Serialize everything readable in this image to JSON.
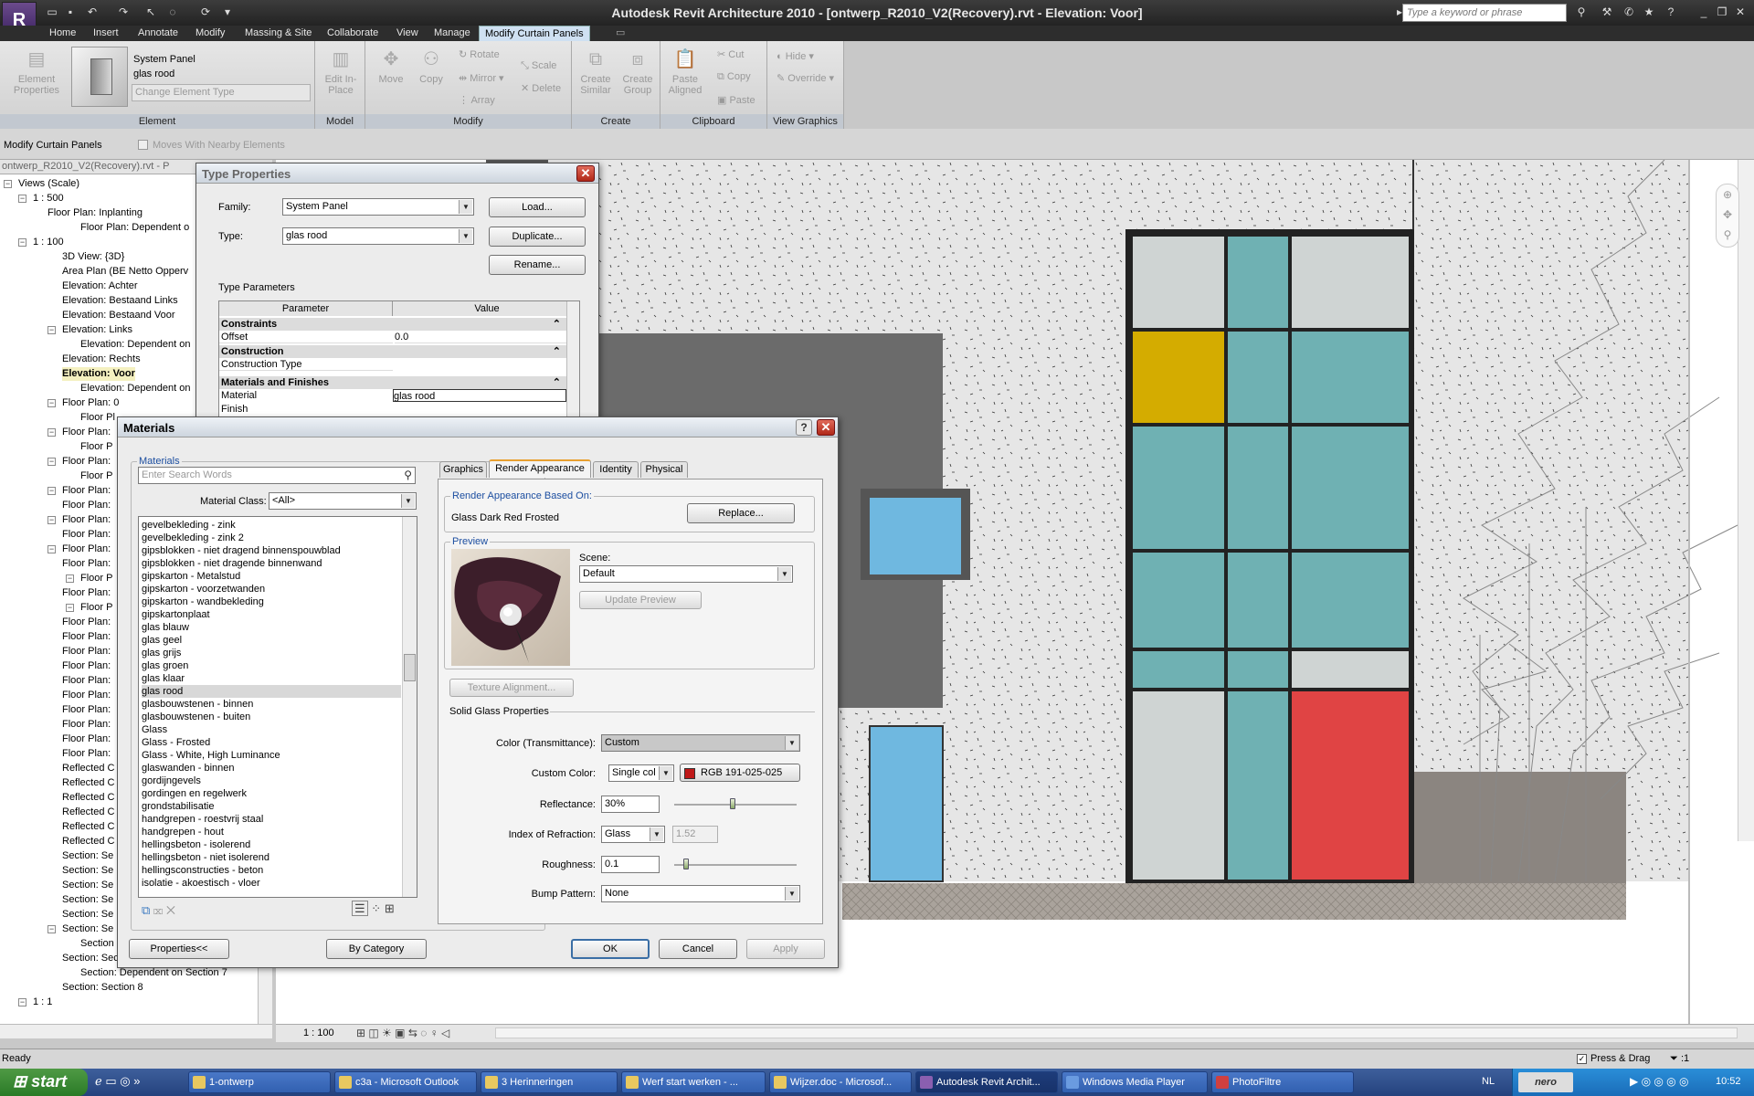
{
  "app": {
    "title": "Autodesk Revit Architecture 2010 - [ontwerp_R2010_V2(Recovery).rvt - Elevation: Voor]",
    "search_placeholder": "Type a keyword or phrase"
  },
  "ribbon": {
    "tabs": [
      "Home",
      "Insert",
      "Annotate",
      "Modify",
      "Massing & Site",
      "Collaborate",
      "View",
      "Manage",
      "Modify Curtain Panels"
    ],
    "element": {
      "props_label": "Element Properties",
      "family": "System Panel",
      "type": "glas rood",
      "change_type": "Change Element Type",
      "panel": "Element"
    },
    "model": {
      "edit_inplace": "Edit In-Place",
      "panel": "Model"
    },
    "modify": {
      "move": "Move",
      "copy": "Copy",
      "rotate": "Rotate",
      "mirror": "Mirror",
      "array": "Array",
      "scale": "Scale",
      "delete": "Delete",
      "panel": "Modify"
    },
    "create": {
      "similar": "Create Similar",
      "group": "Create Group",
      "panel": "Create"
    },
    "clipboard": {
      "paste_aligned": "Paste Aligned",
      "cut": "Cut",
      "copy": "Copy",
      "paste": "Paste",
      "panel": "Clipboard"
    },
    "view_graphics": {
      "hide": "Hide",
      "override": "Override",
      "panel": "View Graphics"
    }
  },
  "options_bar": {
    "context": "Modify Curtain Panels",
    "moves_with": "Moves With Nearby Elements"
  },
  "project_browser": {
    "root": "ontwerp_R2010_V2(Recovery).rvt - P",
    "items": [
      "Views (Scale)",
      "1 : 500",
      "Floor Plan: Inplanting",
      "Floor Plan: Dependent o",
      "1 : 100",
      "3D View: {3D}",
      "Area Plan (BE Netto Opperv",
      "Elevation: Achter",
      "Elevation: Bestaand Links",
      "Elevation: Bestaand Voor",
      "Elevation: Links",
      "Elevation: Dependent on",
      "Elevation: Rechts",
      "Elevation: Voor",
      "Elevation: Dependent on",
      "Floor Plan: 0",
      "Floor Pl",
      "Floor Plan:",
      "Floor P",
      "Floor Plan:",
      "Floor P",
      "Floor Plan:",
      "Floor Plan:",
      "Floor Plan:",
      "Floor Plan:",
      "Floor Plan:",
      "Floor Plan:",
      "Floor P",
      "Floor Plan:",
      "Floor P",
      "Floor Plan:",
      "Floor Plan:",
      "Floor Plan:",
      "Floor Plan:",
      "Floor Plan:",
      "Floor Plan:",
      "Floor Plan:",
      "Floor Plan:",
      "Floor Plan:",
      "Floor Plan:",
      "Reflected C",
      "Reflected C",
      "Reflected C",
      "Reflected C",
      "Reflected C",
      "Reflected C",
      "Section: Se",
      "Section: Se",
      "Section: Se",
      "Section: Se",
      "Section: Se",
      "Section: Se",
      "Section",
      "Section: Section 7",
      "Section: Dependent on Section 7",
      "Section: Section 8",
      "1 : 1"
    ]
  },
  "type_properties": {
    "title": "Type Properties",
    "family_label": "Family:",
    "family_value": "System Panel",
    "type_label": "Type:",
    "type_value": "glas rood",
    "load": "Load...",
    "duplicate": "Duplicate...",
    "rename": "Rename...",
    "params_label": "Type Parameters",
    "col_param": "Parameter",
    "col_value": "Value",
    "g_constraints": "Constraints",
    "offset_label": "Offset",
    "offset_value": "0.0",
    "g_construction": "Construction",
    "ctype_label": "Construction Type",
    "g_materials": "Materials and Finishes",
    "material_label": "Material",
    "material_value": "glas rood",
    "finish_label": "Finish"
  },
  "materials": {
    "title": "Materials",
    "group_label": "Materials",
    "search_placeholder": "Enter Search Words",
    "class_label": "Material Class:",
    "class_value": "<All>",
    "list": [
      "gevelbekleding - zink",
      "gevelbekleding - zink 2",
      "gipsblokken - niet dragend binnenspouwblad",
      "gipsblokken - niet dragende binnenwand",
      "gipskarton - Metalstud",
      "gipskarton - voorzetwanden",
      "gipskarton - wandbekleding",
      "gipskartonplaat",
      "glas blauw",
      "glas geel",
      "glas grijs",
      "glas groen",
      "glas klaar",
      "glas rood",
      "glasbouwstenen - binnen",
      "glasbouwstenen - buiten",
      "Glass",
      "Glass - Frosted",
      "Glass - White, High Luminance",
      "glaswanden - binnen",
      "gordijngevels",
      "gordingen en regelwerk",
      "grondstabilisatie",
      "handgrepen - roestvrij staal",
      "handgrepen - hout",
      "hellingsbeton - isolerend",
      "hellingsbeton - niet isolerend",
      "hellingsconstructies - beton",
      "isolatie - akoestisch - vloer"
    ],
    "selected": "glas rood",
    "tabs": [
      "Graphics",
      "Render Appearance",
      "Identity",
      "Physical"
    ],
    "based_on_label": "Render Appearance Based On:",
    "based_on_value": "Glass Dark Red Frosted",
    "replace": "Replace...",
    "preview_label": "Preview",
    "scene_label": "Scene:",
    "scene_value": "Default",
    "update_preview": "Update Preview",
    "texture_alignment": "Texture Alignment...",
    "solid_glass": "Solid Glass Properties",
    "color_label": "Color (Transmittance):",
    "color_value": "Custom",
    "custom_color_label": "Custom Color:",
    "custom_color_mode": "Single col",
    "custom_color_rgb": "RGB 191-025-025",
    "custom_color_hex": "#bf1919",
    "reflectance_label": "Reflectance:",
    "reflectance_value": "30%",
    "ior_label": "Index of Refraction:",
    "ior_type": "Glass",
    "ior_value": "1.52",
    "roughness_label": "Roughness:",
    "roughness_value": "0.1",
    "bump_label": "Bump Pattern:",
    "bump_value": "None",
    "properties_btn": "Properties<<",
    "by_category": "By Category",
    "ok": "OK",
    "cancel": "Cancel",
    "apply": "Apply"
  },
  "view": {
    "scale": "1 : 100"
  },
  "status": {
    "ready": "Ready",
    "press_drag": "Press & Drag",
    "filter_count": ":1"
  },
  "taskbar": {
    "start": "start",
    "items": [
      "1-ontwerp",
      "c3a - Microsoft Outlook",
      "3 Herinneringen",
      "Werf start werken - ...",
      "Wijzer.doc - Microsof...",
      "Autodesk Revit Archit...",
      "Windows Media Player",
      "PhotoFiltre"
    ],
    "lang": "NL",
    "clock": "10:52",
    "nero": "nero"
  }
}
